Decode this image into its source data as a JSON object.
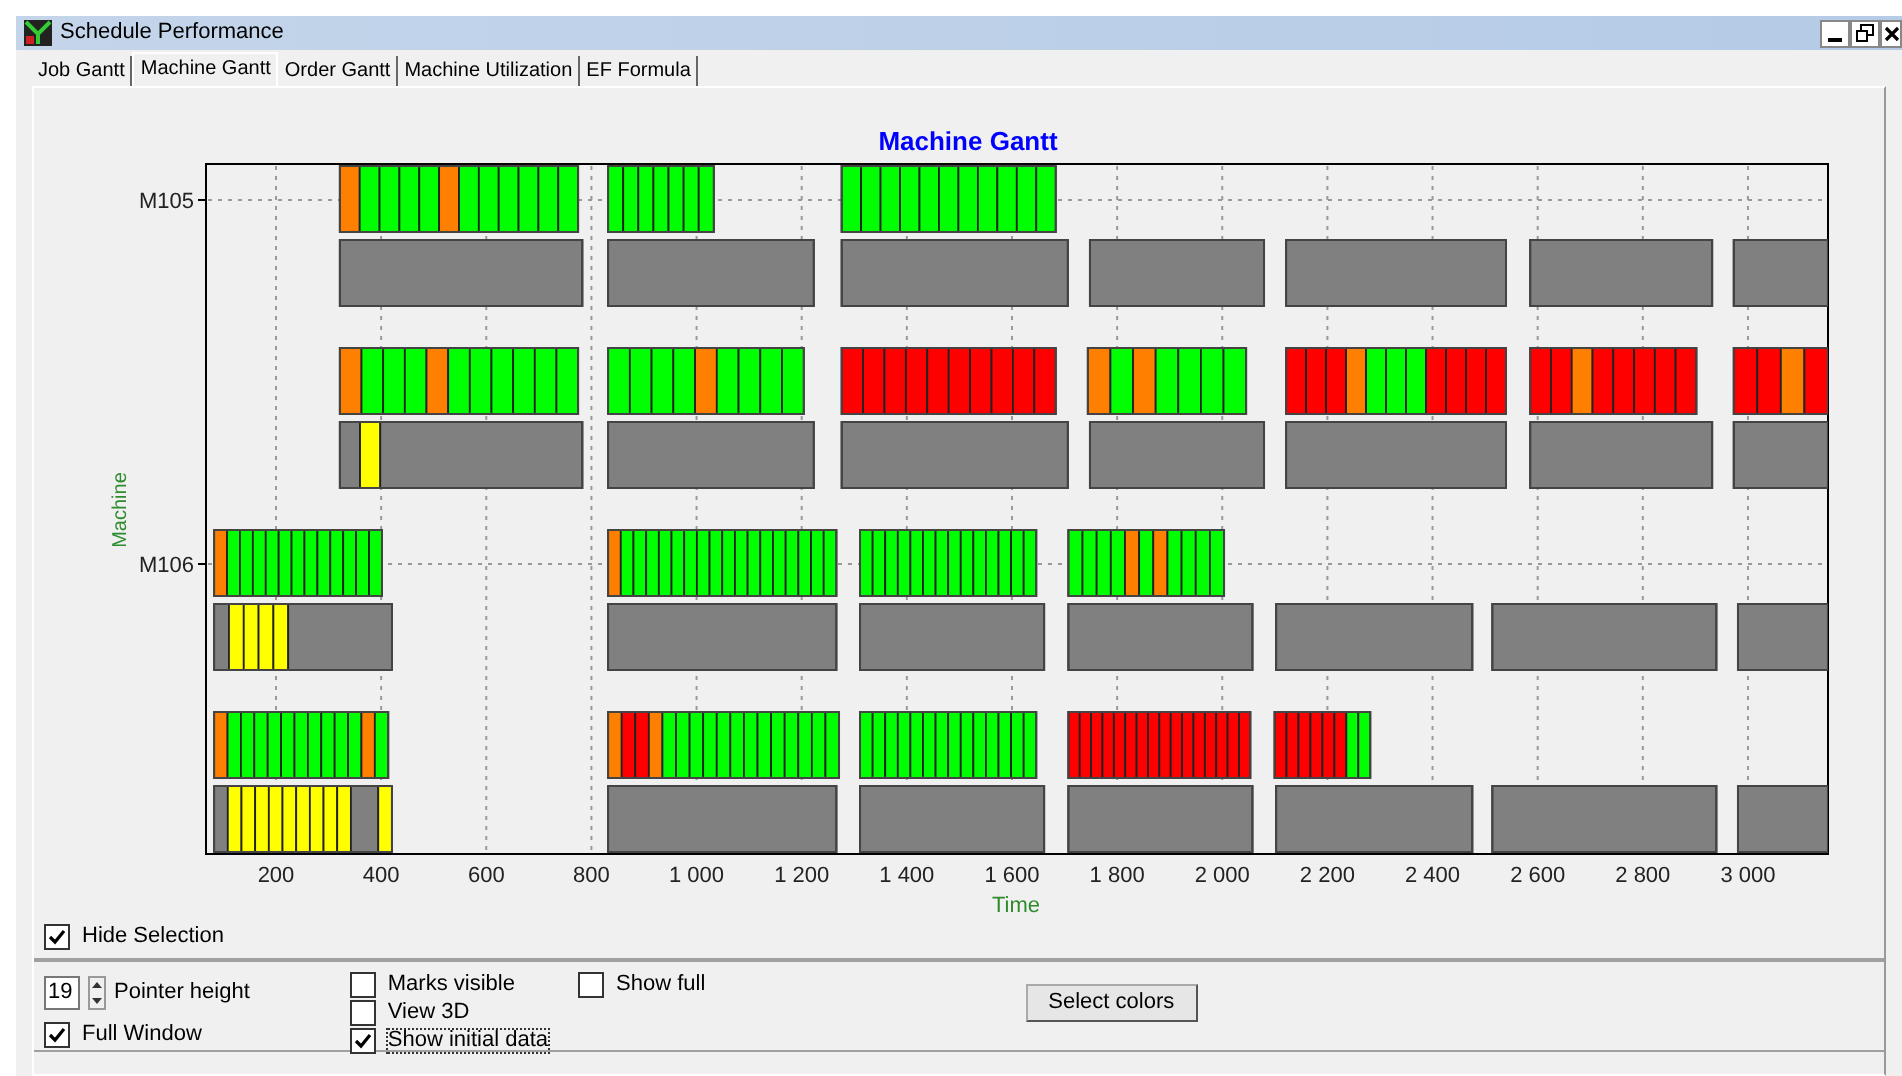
{
  "window": {
    "title": "Schedule Performance"
  },
  "tabs": [
    {
      "label": "Job Gantt",
      "selected": false
    },
    {
      "label": "Machine Gantt",
      "selected": true
    },
    {
      "label": "Order Gantt",
      "selected": false
    },
    {
      "label": "Machine Utilization",
      "selected": false
    },
    {
      "label": "EF Formula",
      "selected": false
    }
  ],
  "chart": {
    "title": "Machine Gantt",
    "ylabel": "Machine",
    "xlabel": "Time",
    "machines": [
      "M105",
      "M106"
    ],
    "time_ticks": [
      "200",
      "400",
      "600",
      "800",
      "1 000",
      "1 200",
      "1 400",
      "1 600",
      "1 800",
      "2 000",
      "2 200",
      "2 400",
      "2 600",
      "2 800",
      "3 000"
    ],
    "hide_selection": {
      "label": "Hide Selection",
      "checked": true
    }
  },
  "controls": {
    "pointer_height": {
      "value": "19",
      "label": "Pointer height"
    },
    "checkboxes": [
      {
        "label": "Full Window",
        "checked": true
      },
      {
        "label": "Marks visible",
        "checked": false
      },
      {
        "label": "View 3D",
        "checked": false
      },
      {
        "label": "Show initial data",
        "checked": true
      },
      {
        "label": "Show full",
        "checked": false
      }
    ],
    "button": "Select colors"
  }
}
